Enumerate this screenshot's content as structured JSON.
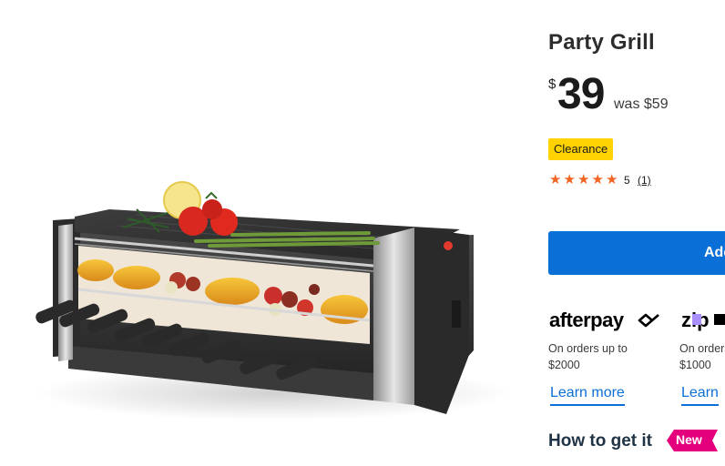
{
  "product": {
    "title": "Party Grill",
    "price_currency": "$",
    "price_value": "39",
    "was_price": "was $59",
    "badge": "Clearance",
    "rating_value": "5",
    "rating_count": "(1)",
    "stars": 5,
    "image_icon": "party-grill-photo"
  },
  "actions": {
    "add_button_label": "Add"
  },
  "payments": {
    "afterpay": {
      "logo_text": "afterpay",
      "line1": "On orders up to",
      "line2": "$2000",
      "link": "Learn more"
    },
    "zip": {
      "logo_text": "zip",
      "line1": "On orders",
      "line2": "$1000",
      "link": "Learn"
    }
  },
  "delivery": {
    "title": "How to get it",
    "new_badge": "New"
  },
  "colors": {
    "primary_blue": "#0a6fd6",
    "clearance_yellow": "#ffd200",
    "star_orange": "#f26422",
    "new_pink": "#e4007c",
    "heading_navy": "#1f3345"
  }
}
